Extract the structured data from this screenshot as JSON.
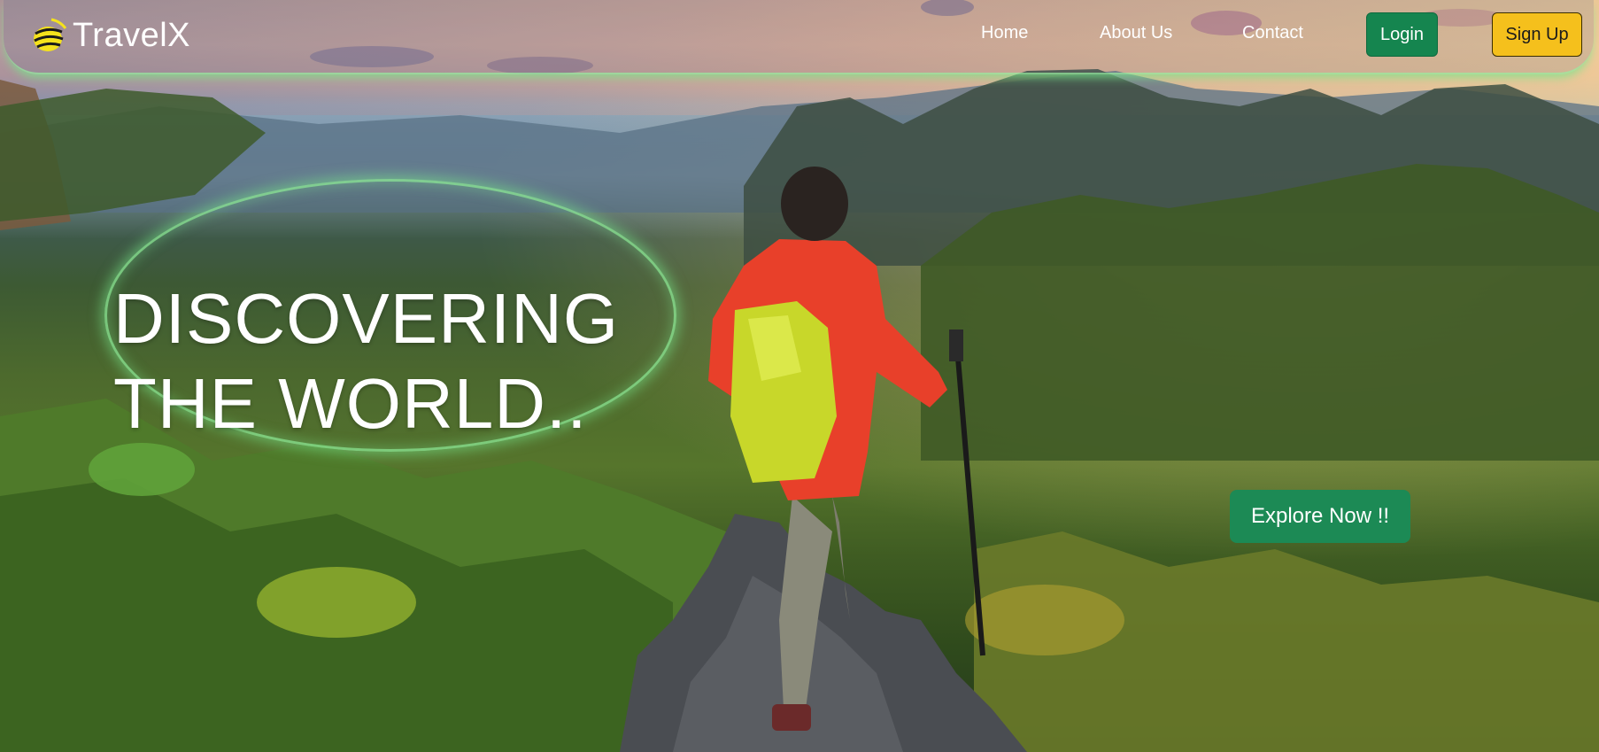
{
  "brand": {
    "name": "TravelX",
    "icon": "globe-icon",
    "icon_color": "#f5e21c"
  },
  "nav": {
    "items": [
      {
        "label": "Home"
      },
      {
        "label": "About Us"
      },
      {
        "label": "Contact"
      }
    ],
    "login_label": "Login",
    "signup_label": "Sign Up"
  },
  "hero": {
    "title_line1": "DISCOVERING",
    "title_line2": "THE WORLD..",
    "explore_label": "Explore Now !!"
  },
  "colors": {
    "login_bg": "#15854f",
    "signup_bg": "#f5c01c",
    "explore_bg": "#1c8a55",
    "glow": "#8ceb96"
  }
}
